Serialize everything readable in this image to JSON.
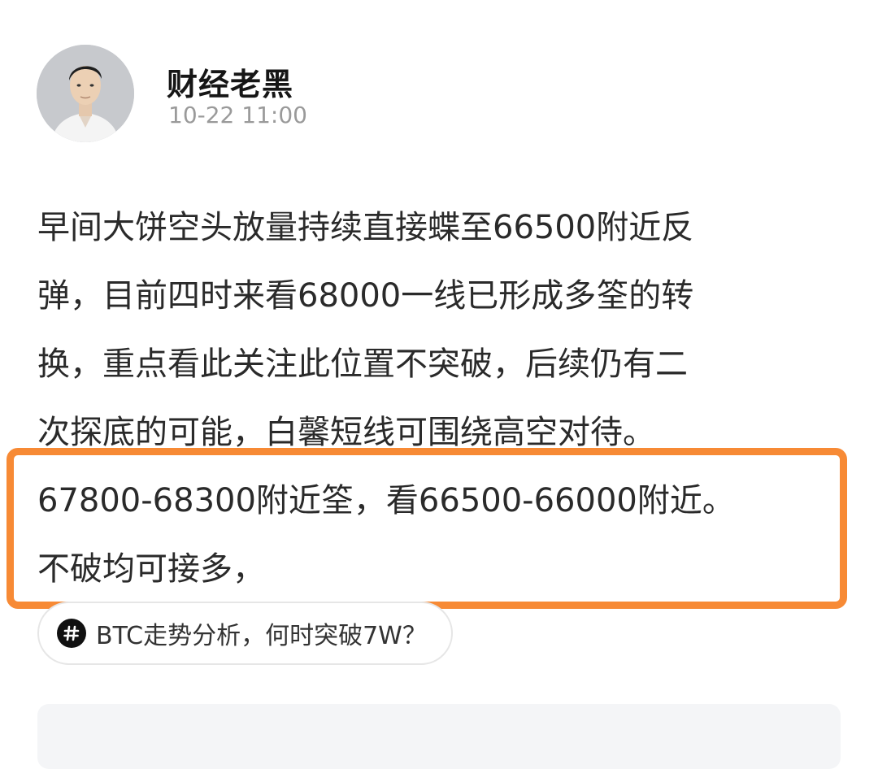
{
  "author": {
    "name": "财经老黑",
    "timestamp": "10-22 11:00",
    "avatar_icon": "profile-photo"
  },
  "post": {
    "lines": [
      "早间大饼空头放量持续直接蝶至66500附近反",
      "弹，目前四时来看68000一线已形成多筌的转",
      "换，重点看此关注此位置不突破，后续仍有二",
      "次探底的可能，白馨短线可围绕高空对待。",
      "67800-68300附近筌，看66500-66000附近。",
      "不破均可接多，"
    ]
  },
  "highlight": {
    "color": "#f78a35"
  },
  "topic": {
    "icon": "hash-icon",
    "label": "BTC走势分析，何时突破7W？"
  }
}
